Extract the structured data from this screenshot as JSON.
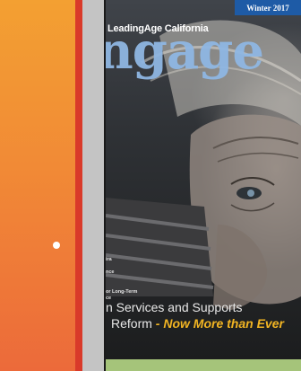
{
  "cover": {
    "issue": "Winter 2017",
    "brand": "LeadingAge California",
    "masthead": "ngage",
    "sidebar_snippets": [
      "ira",
      "nce",
      "or Long-Term",
      "ce"
    ],
    "headline_line1": "n Services and Supports",
    "headline_line2_lead": "Reform",
    "headline_line2_accent": "- Now More than Ever"
  },
  "colors": {
    "left_panel_top": "#f3a032",
    "left_panel_bottom": "#ec6a3a",
    "issue_badge": "#1e5ba6",
    "masthead": "#8fb7e3",
    "accent": "#f2b523"
  }
}
